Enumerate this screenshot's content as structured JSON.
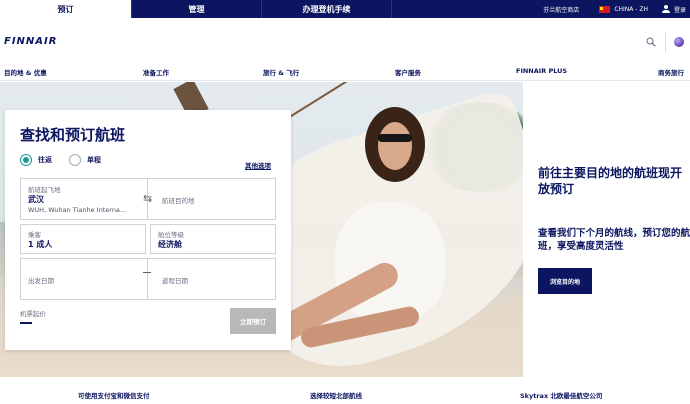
{
  "top_tabs": [
    "预订",
    "管理",
    "办理登机手续"
  ],
  "top_right": {
    "shop": "芬兰航空商店",
    "locale": "CHINA - ZH",
    "login": "登录"
  },
  "logo": "FINNAIR",
  "icons": {
    "search": "search-icon",
    "globe": "globe-icon",
    "user": "user-icon",
    "flag": "china-flag-icon",
    "swap": "swap-arrows-icon"
  },
  "nav": [
    "目的地 & 优惠",
    "准备工作",
    "旅行 & 飞行",
    "客户服务",
    "FINNAIR PLUS",
    "商务旅行"
  ],
  "booking": {
    "title": "查找和预订航班",
    "trip_types": [
      "往返",
      "单程"
    ],
    "selected_trip_type": "往返",
    "more_options": "其他选项",
    "origin": {
      "label": "航班起飞地",
      "value": "武汉",
      "sub": "WUH, Wuhan Tianhe Interna..."
    },
    "destination": {
      "placeholder": "航班目的地"
    },
    "passengers": {
      "label": "乘客",
      "value": "1 成人"
    },
    "cabin": {
      "label": "舱位等级",
      "value": "经济舱"
    },
    "depart": {
      "placeholder": "出发日期"
    },
    "return": {
      "placeholder": "返程日期"
    },
    "price_label": "机票起价",
    "submit": "立即预订"
  },
  "promo": {
    "title": "前往主要目的地的航班现开放预订",
    "body": "查看我们下个月的航线，预订您的航班，享受高度灵活性",
    "button": "浏览目的地"
  },
  "footer": [
    "可使用支付宝和微信支付",
    "选择较短北部航线",
    "Skytrax 北欧最佳航空公司"
  ],
  "colors": {
    "brand_navy": "#0b1560",
    "accent_teal": "#1a9a9a",
    "disabled_button": "#b8b8b8"
  }
}
